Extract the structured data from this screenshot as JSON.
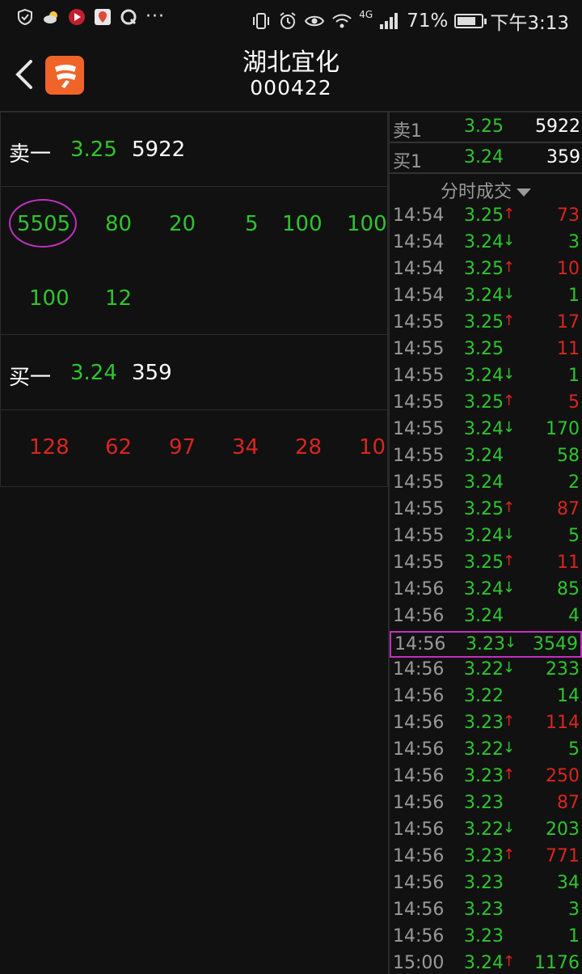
{
  "status_bar": {
    "time": "下午3:13",
    "battery": "71%",
    "network": "4G",
    "more": "···"
  },
  "header": {
    "title": "湖北宜化",
    "code": "000422"
  },
  "left_panel": {
    "sell": {
      "label": "卖一",
      "price": "3.25",
      "volume": "5922"
    },
    "sell_queue_row1": [
      "5505",
      "80",
      "20",
      "5",
      "100",
      "100"
    ],
    "sell_queue_row2": [
      "100",
      "12"
    ],
    "buy": {
      "label": "买一",
      "price": "3.24",
      "volume": "359"
    },
    "buy_queue_row1": [
      "128",
      "62",
      "97",
      "34",
      "28",
      "10"
    ]
  },
  "right_panel": {
    "sell1": {
      "label": "卖1",
      "price": "3.25",
      "volume": "5922"
    },
    "buy1": {
      "label": "买1",
      "price": "3.24",
      "volume": "359"
    },
    "trades_title": "分时成交",
    "trades": [
      {
        "time": "14:54",
        "price": "3.25",
        "arrow": "↑",
        "vol": "73",
        "dir": "up"
      },
      {
        "time": "14:54",
        "price": "3.24",
        "arrow": "↓",
        "vol": "3",
        "dir": "down"
      },
      {
        "time": "14:54",
        "price": "3.25",
        "arrow": "↑",
        "vol": "10",
        "dir": "up"
      },
      {
        "time": "14:54",
        "price": "3.24",
        "arrow": "↓",
        "vol": "1",
        "dir": "down"
      },
      {
        "time": "14:55",
        "price": "3.25",
        "arrow": "↑",
        "vol": "17",
        "dir": "up"
      },
      {
        "time": "14:55",
        "price": "3.25",
        "arrow": "",
        "vol": "11",
        "dir": "up"
      },
      {
        "time": "14:55",
        "price": "3.24",
        "arrow": "↓",
        "vol": "1",
        "dir": "down"
      },
      {
        "time": "14:55",
        "price": "3.25",
        "arrow": "↑",
        "vol": "5",
        "dir": "up"
      },
      {
        "time": "14:55",
        "price": "3.24",
        "arrow": "↓",
        "vol": "170",
        "dir": "down"
      },
      {
        "time": "14:55",
        "price": "3.24",
        "arrow": "",
        "vol": "58",
        "dir": "down"
      },
      {
        "time": "14:55",
        "price": "3.24",
        "arrow": "",
        "vol": "2",
        "dir": "down"
      },
      {
        "time": "14:55",
        "price": "3.25",
        "arrow": "↑",
        "vol": "87",
        "dir": "up"
      },
      {
        "time": "14:55",
        "price": "3.24",
        "arrow": "↓",
        "vol": "5",
        "dir": "down"
      },
      {
        "time": "14:55",
        "price": "3.25",
        "arrow": "↑",
        "vol": "11",
        "dir": "up"
      },
      {
        "time": "14:56",
        "price": "3.24",
        "arrow": "↓",
        "vol": "85",
        "dir": "down"
      },
      {
        "time": "14:56",
        "price": "3.24",
        "arrow": "",
        "vol": "4",
        "dir": "down"
      },
      {
        "time": "14:56",
        "price": "3.23",
        "arrow": "↓",
        "vol": "3549",
        "dir": "down",
        "highlight": true
      },
      {
        "time": "14:56",
        "price": "3.22",
        "arrow": "↓",
        "vol": "233",
        "dir": "down"
      },
      {
        "time": "14:56",
        "price": "3.22",
        "arrow": "",
        "vol": "14",
        "dir": "down"
      },
      {
        "time": "14:56",
        "price": "3.23",
        "arrow": "↑",
        "vol": "114",
        "dir": "up"
      },
      {
        "time": "14:56",
        "price": "3.22",
        "arrow": "↓",
        "vol": "5",
        "dir": "down"
      },
      {
        "time": "14:56",
        "price": "3.23",
        "arrow": "↑",
        "vol": "250",
        "dir": "up"
      },
      {
        "time": "14:56",
        "price": "3.23",
        "arrow": "",
        "vol": "87",
        "dir": "up"
      },
      {
        "time": "14:56",
        "price": "3.22",
        "arrow": "↓",
        "vol": "203",
        "dir": "down"
      },
      {
        "time": "14:56",
        "price": "3.23",
        "arrow": "↑",
        "vol": "771",
        "dir": "up"
      },
      {
        "time": "14:56",
        "price": "3.23",
        "arrow": "",
        "vol": "34",
        "dir": "down"
      },
      {
        "time": "14:56",
        "price": "3.23",
        "arrow": "",
        "vol": "3",
        "dir": "down"
      },
      {
        "time": "14:56",
        "price": "3.23",
        "arrow": "",
        "vol": "1",
        "dir": "down"
      },
      {
        "time": "15:00",
        "price": "3.24",
        "arrow": "↑",
        "vol": "1176",
        "dir": "down"
      }
    ]
  },
  "colors": {
    "up": "#d9251f",
    "down": "#2ec52e",
    "highlight": "#c030c0",
    "brand": "#f0642a"
  }
}
